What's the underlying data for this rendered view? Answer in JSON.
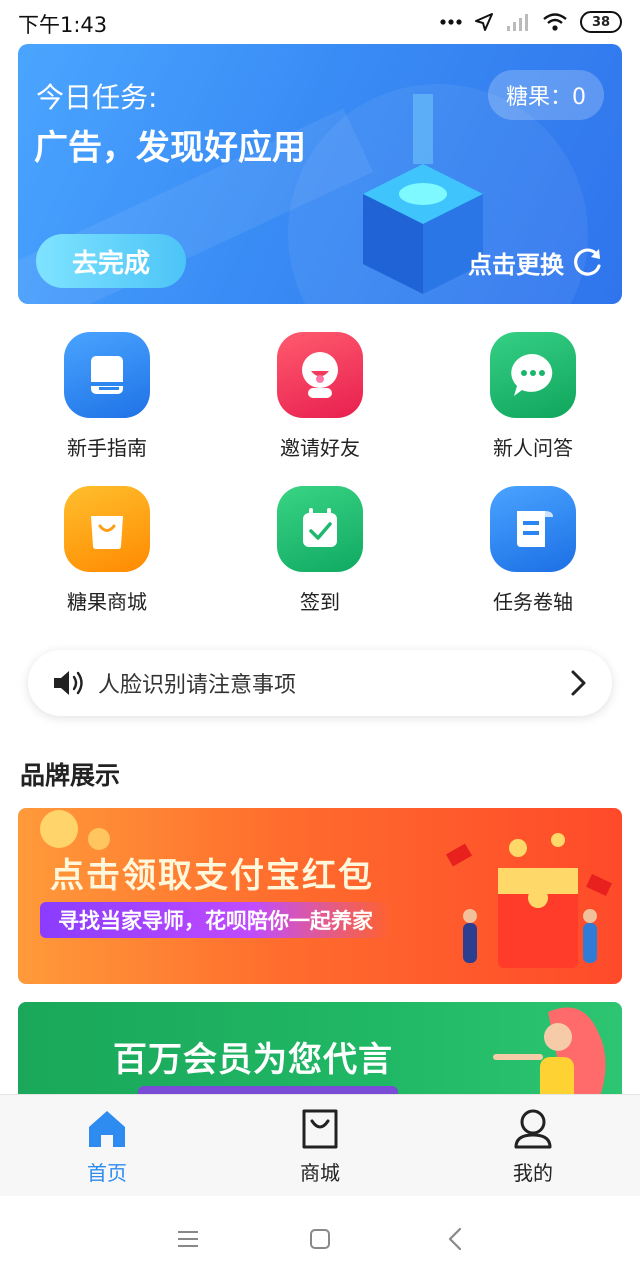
{
  "status_bar": {
    "time": "下午1:43",
    "battery": "38"
  },
  "task_banner": {
    "label": "今日任务:",
    "headline": "广告，发现好应用",
    "candy": "糖果：0",
    "go_button": "去完成",
    "switch_label": "点击更换"
  },
  "grid": {
    "items": [
      {
        "label": "新手指南",
        "icon": "book-icon",
        "color": "#2e86f0"
      },
      {
        "label": "邀请好友",
        "icon": "smiley-person-icon",
        "color": "#f23a5a"
      },
      {
        "label": "新人问答",
        "icon": "chat-bubble-icon",
        "color": "#19b66a"
      },
      {
        "label": "糖果商城",
        "icon": "shopping-bag-icon",
        "color": "#ff9e12"
      },
      {
        "label": "签到",
        "icon": "calendar-check-icon",
        "color": "#1fb86f"
      },
      {
        "label": "任务卷轴",
        "icon": "scroll-icon",
        "color": "#2b86f2"
      }
    ]
  },
  "notice": {
    "text": "人脸识别请注意事项"
  },
  "brand_section": {
    "title": "品牌展示",
    "banner_1": {
      "title": "点击领取支付宝红包",
      "subtitle": "寻找当家导师，花呗陪你一起养家"
    },
    "banner_2": {
      "title": "百万会员为您代言"
    }
  },
  "tab_bar": {
    "tabs": [
      {
        "label": "首页",
        "icon": "home-icon",
        "active": true
      },
      {
        "label": "商城",
        "icon": "bag-icon",
        "active": false
      },
      {
        "label": "我的",
        "icon": "user-icon",
        "active": false
      }
    ],
    "active_color": "#2e8cf0",
    "inactive_color": "#222222"
  }
}
